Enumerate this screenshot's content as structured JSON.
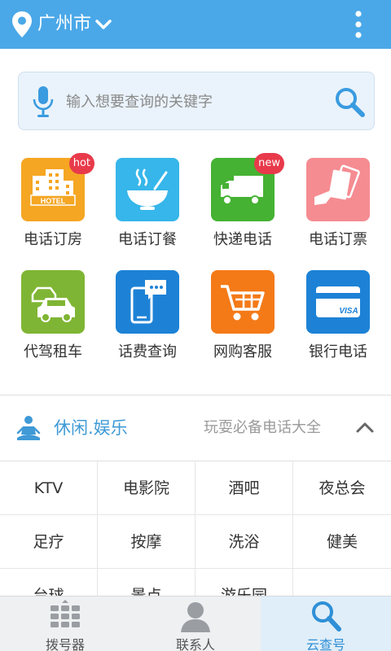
{
  "header": {
    "city": "广州市",
    "bg_color": "#4aa8e8"
  },
  "search": {
    "placeholder": "输入想要查询的关键字"
  },
  "services": [
    {
      "label": "电话订房",
      "icon": "hotel-icon",
      "color": "#f5a623",
      "badge": "hot"
    },
    {
      "label": "电话订餐",
      "icon": "bowl-icon",
      "color": "#36b6ea",
      "badge": ""
    },
    {
      "label": "快递电话",
      "icon": "truck-icon",
      "color": "#45b233",
      "badge": "new"
    },
    {
      "label": "电话订票",
      "icon": "ticket-icon",
      "color": "#f58c92",
      "badge": ""
    },
    {
      "label": "代驾租车",
      "icon": "car-icon",
      "color": "#7fb534",
      "badge": ""
    },
    {
      "label": "话费查询",
      "icon": "phone-icon",
      "color": "#1d82d6",
      "badge": ""
    },
    {
      "label": "网购客服",
      "icon": "cart-icon",
      "color": "#f47a18",
      "badge": ""
    },
    {
      "label": "银行电话",
      "icon": "card-icon",
      "color": "#1d82d6",
      "badge": ""
    }
  ],
  "section": {
    "title": "休闲.娱乐",
    "subtitle": "玩耍必备电话大全",
    "icon": "meditation-icon"
  },
  "categories": [
    "KTV",
    "电影院",
    "酒吧",
    "夜总会",
    "足疗",
    "按摩",
    "洗浴",
    "健美",
    "台球",
    "景点",
    "游乐园",
    ""
  ],
  "nav": [
    {
      "label": "拨号器",
      "icon": "dialpad-icon",
      "active": false
    },
    {
      "label": "联系人",
      "icon": "contact-icon",
      "active": false
    },
    {
      "label": "云查号",
      "icon": "search-icon",
      "active": true
    }
  ]
}
